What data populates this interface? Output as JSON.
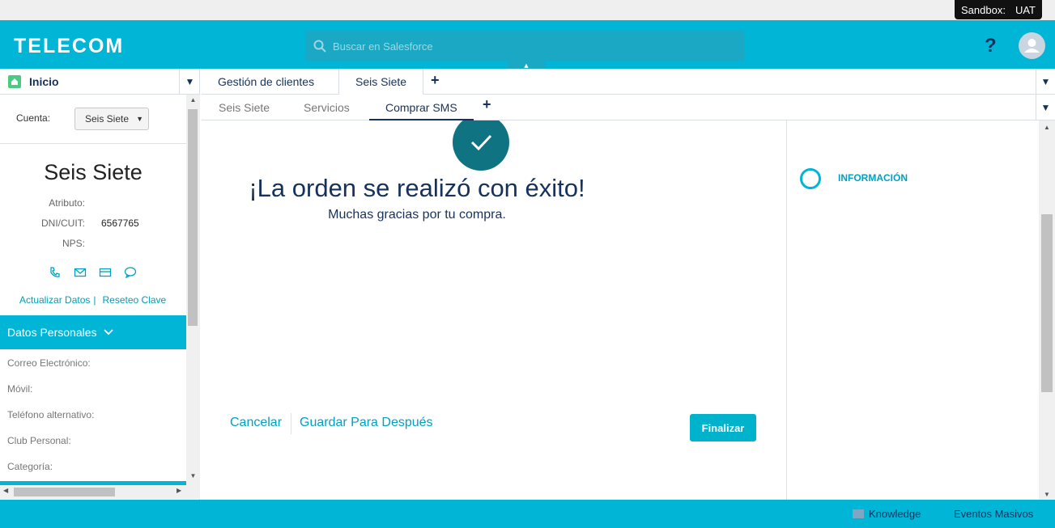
{
  "sandbox": {
    "label": "Sandbox:",
    "env": "UAT"
  },
  "header": {
    "logo": "TELECOM",
    "search_placeholder": "Buscar en Salesforce",
    "help": "?"
  },
  "sidebar": {
    "home_label": "Inicio",
    "cuenta_label": "Cuenta:",
    "cuenta_value": "Seis Siete",
    "account_name": "Seis Siete",
    "attributes": [
      {
        "label": "Atributo:",
        "value": ""
      },
      {
        "label": "DNI/CUIT:",
        "value": "6567765"
      },
      {
        "label": "NPS:",
        "value": ""
      }
    ],
    "link_update": "Actualizar Datos",
    "link_sep": "|",
    "link_reset": "Reseteo Clave",
    "section_title": "Datos Personales",
    "fields": [
      "Correo Electrónico:",
      "Móvil:",
      "Teléfono alternativo:",
      "Club Personal:",
      "Categoría:"
    ]
  },
  "primary_tabs": [
    "Gestión de clientes",
    "Seis Siete"
  ],
  "sub_tabs": [
    "Seis Siete",
    "Servicios",
    "Comprar SMS"
  ],
  "main": {
    "title": "¡La orden se realizó con éxito!",
    "subtitle": "Muchas gracias por tu compra.",
    "cancel": "Cancelar",
    "save_later": "Guardar Para Después",
    "finish": "Finalizar"
  },
  "right_panel": {
    "step_label": "INFORMACIÓN"
  },
  "footer": {
    "knowledge": "Knowledge",
    "events": "Eventos Masivos"
  },
  "colors": {
    "brand": "#00b5d6",
    "navy": "#16325c",
    "success": "#0f7382"
  }
}
